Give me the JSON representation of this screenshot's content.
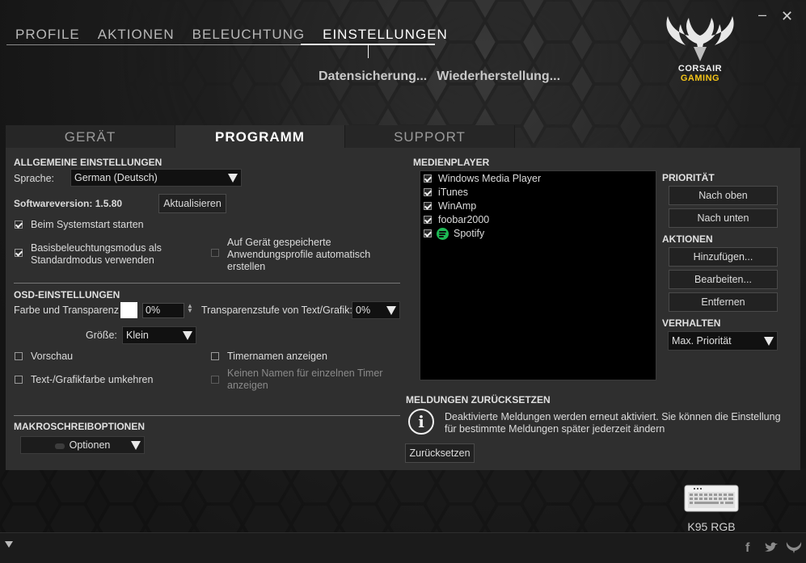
{
  "nav": {
    "items": [
      "PROFILE",
      "AKTIONEN",
      "BELEUCHTUNG",
      "EINSTELLUNGEN"
    ],
    "active": "EINSTELLUNGEN"
  },
  "sublinks": {
    "backup": "Datensicherung...",
    "restore": "Wiederherstellung..."
  },
  "window": {
    "minimize": "–",
    "close": "✕"
  },
  "logo": {
    "line1": "CORSAIR",
    "line2": "GAMING"
  },
  "tabs": [
    "GERÄT",
    "PROGRAMM",
    "SUPPORT"
  ],
  "general": {
    "title": "ALLGEMEINE EINSTELLUNGEN",
    "language_label": "Sprache:",
    "language_value": "German (Deutsch)",
    "version_label": "Softwareversion: 1.5.80",
    "update_button": "Aktualisieren",
    "startup_label": "Beim Systemstart starten",
    "basic_lighting_label": "Basisbeleuchtungsmodus als Standardmodus verwenden",
    "auto_profiles_label": "Auf Gerät gespeicherte Anwendungsprofile automatisch erstellen"
  },
  "osd": {
    "title": "OSD-EINSTELLUNGEN",
    "color_label": "Farbe und Transparenz",
    "color_value": "0%",
    "text_transparency_label": "Transparenzstufe von Text/Grafik:",
    "text_transparency_value": "0%",
    "size_label": "Größe:",
    "size_value": "Klein",
    "preview_label": "Vorschau",
    "timer_names_label": "Timernamen anzeigen",
    "invert_label": "Text-/Grafikfarbe umkehren",
    "no_single_timer_label": "Keinen Namen für einzelnen Timer anzeigen"
  },
  "macro": {
    "title": "MAKROSCHREIBOPTIONEN",
    "options_button": "Optionen"
  },
  "media": {
    "title": "MEDIENPLAYER",
    "players": [
      "Windows Media Player",
      "iTunes",
      "WinAmp",
      "foobar2000",
      "Spotify"
    ],
    "priority_title": "PRIORITÄT",
    "up_button": "Nach oben",
    "down_button": "Nach unten",
    "actions_title": "AKTIONEN",
    "add_button": "Hinzufügen...",
    "edit_button": "Bearbeiten...",
    "remove_button": "Entfernen",
    "behavior_title": "VERHALTEN",
    "behavior_value": "Max. Priorität"
  },
  "messages": {
    "title": "MELDUNGEN ZURÜCKSETZEN",
    "text": "Deaktivierte Meldungen werden erneut aktiviert. Sie können die Einstellung für bestimmte Meldungen später jederzeit ändern",
    "reset_button": "Zurücksetzen"
  },
  "device": {
    "name": "K95 RGB"
  }
}
